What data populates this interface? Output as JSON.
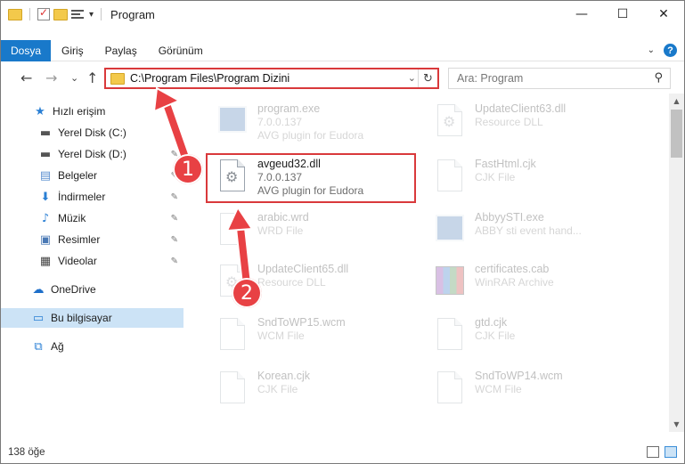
{
  "window": {
    "title": "Program",
    "controls": {
      "minimize": "—",
      "maximize": "☐",
      "close": "✕"
    }
  },
  "ribbon": {
    "tabs": [
      "Dosya",
      "Giriş",
      "Paylaş",
      "Görünüm"
    ],
    "expand": "⌄",
    "help": "?"
  },
  "nav": {
    "back": "←",
    "forward": "→",
    "recent": "⌄",
    "up": "↑",
    "address": "C:\\Program Files\\Program Dizini",
    "address_dropdown": "⌄",
    "refresh": "↻",
    "search_placeholder": "Ara: Program",
    "search_icon": "⚲"
  },
  "sidebar": {
    "items": [
      {
        "label": "Hızlı erişim",
        "icon": "star-icon"
      },
      {
        "label": "Yerel Disk (C:)",
        "icon": "drive-icon",
        "pinned": true
      },
      {
        "label": "Yerel Disk (D:)",
        "icon": "drive-icon",
        "pinned": true
      },
      {
        "label": "Belgeler",
        "icon": "documents-icon",
        "pinned": true
      },
      {
        "label": "İndirmeler",
        "icon": "downloads-icon",
        "pinned": true
      },
      {
        "label": "Müzik",
        "icon": "music-icon",
        "pinned": true
      },
      {
        "label": "Resimler",
        "icon": "pictures-icon",
        "pinned": true
      },
      {
        "label": "Videolar",
        "icon": "videos-icon",
        "pinned": true
      },
      {
        "label": "OneDrive",
        "icon": "cloud-icon"
      },
      {
        "label": "Bu bilgisayar",
        "icon": "computer-icon",
        "selected": true
      },
      {
        "label": "Ağ",
        "icon": "network-icon"
      }
    ],
    "pin_glyph": "📌"
  },
  "files": [
    {
      "name": "program.exe",
      "line2": "7.0.0.137",
      "line3": "AVG plugin for Eudora",
      "icon": "exe-icon"
    },
    {
      "name": "UpdateClient63.dll",
      "line2": "Resource DLL",
      "line3": "",
      "icon": "dll-icon"
    },
    {
      "name": "avgeud32.dll",
      "line2": "7.0.0.137",
      "line3": "AVG plugin for Eudora",
      "icon": "dll-icon",
      "highlighted": true
    },
    {
      "name": "FastHtml.cjk",
      "line2": "CJK File",
      "line3": "",
      "icon": "file-icon"
    },
    {
      "name": "arabic.wrd",
      "line2": "WRD File",
      "line3": "",
      "icon": "file-icon"
    },
    {
      "name": "AbbyySTI.exe",
      "line2": "ABBY sti event hand...",
      "line3": "",
      "icon": "exe-icon"
    },
    {
      "name": "UpdateClient65.dll",
      "line2": "Resource DLL",
      "line3": "",
      "icon": "dll-icon"
    },
    {
      "name": "certificates.cab",
      "line2": "WinRAR Archive",
      "line3": "",
      "icon": "winrar-icon"
    },
    {
      "name": "SndToWP15.wcm",
      "line2": "WCM File",
      "line3": "",
      "icon": "file-icon"
    },
    {
      "name": "gtd.cjk",
      "line2": "CJK File",
      "line3": "",
      "icon": "file-icon"
    },
    {
      "name": "Korean.cjk",
      "line2": "CJK File",
      "line3": "",
      "icon": "file-icon"
    },
    {
      "name": "SndToWP14.wcm",
      "line2": "WCM File",
      "line3": "",
      "icon": "file-icon"
    }
  ],
  "status": {
    "item_count": "138 öğe"
  },
  "annotations": {
    "step1": "1",
    "step2": "2",
    "accent": "#e84144"
  }
}
